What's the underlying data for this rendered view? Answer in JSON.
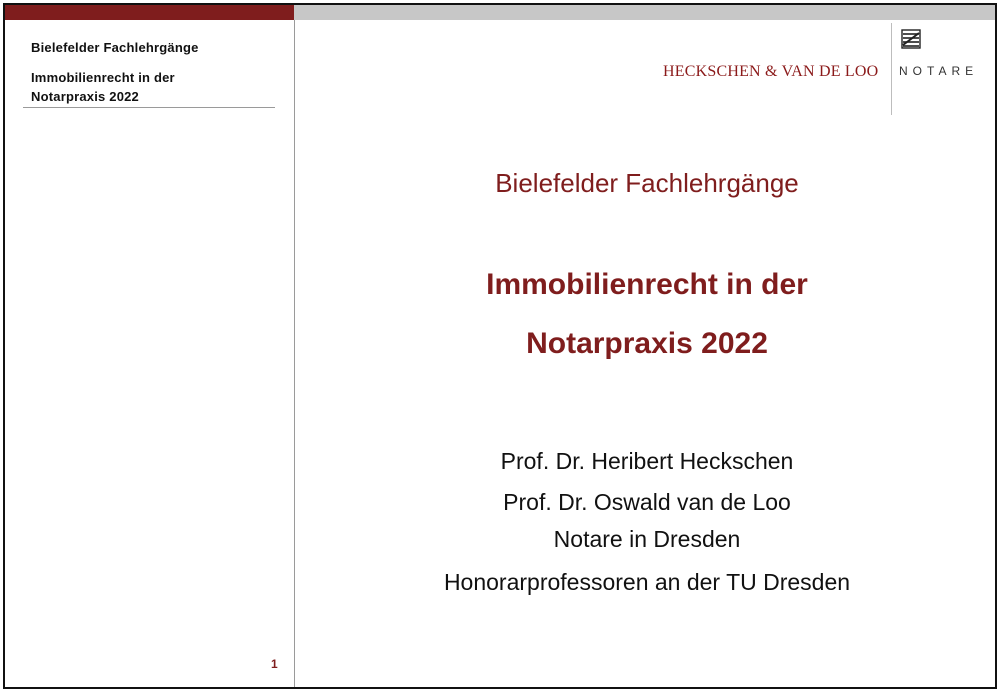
{
  "sidebar": {
    "header": "Bielefelder Fachlehrgänge",
    "course_line1": "Immobilienrecht in der",
    "course_line2": "Notarpraxis 2022",
    "page_number": "1"
  },
  "logo": {
    "firm": "HECKSCHEN & VAN DE LOO",
    "notare": "NOTARE",
    "crest_icon": "saxony-crest-icon"
  },
  "slide": {
    "subtitle": "Bielefelder Fachlehrgänge",
    "title_line1": "Immobilienrecht in der",
    "title_line2": "Notarpraxis 2022",
    "author1": "Prof. Dr. Heribert Heckschen",
    "author2": "Prof. Dr. Oswald van de Loo",
    "author_role": "Notare in Dresden",
    "author_affiliation": "Honorarprofessoren an der TU Dresden"
  },
  "colors": {
    "accent": "#7f1d1d",
    "logo_text": "#8b1a1a",
    "top_bar_grey": "#c7c7c7"
  }
}
